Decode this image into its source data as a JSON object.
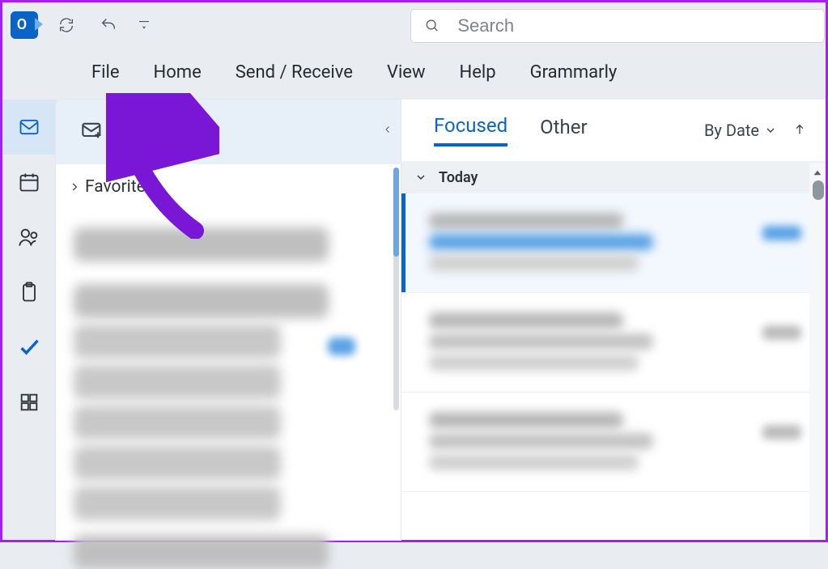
{
  "search": {
    "placeholder": "Search"
  },
  "ribbon": {
    "tabs": [
      "File",
      "Home",
      "Send / Receive",
      "View",
      "Help",
      "Grammarly"
    ]
  },
  "rail": {
    "items": [
      "mail",
      "calendar",
      "people",
      "notes",
      "tasks",
      "apps"
    ]
  },
  "folderpane": {
    "new_email_label": "New Email",
    "favorites_label": "Favorites"
  },
  "msglist": {
    "tabs": {
      "focused": "Focused",
      "other": "Other"
    },
    "sort_label": "By Date",
    "group_today": "Today"
  }
}
